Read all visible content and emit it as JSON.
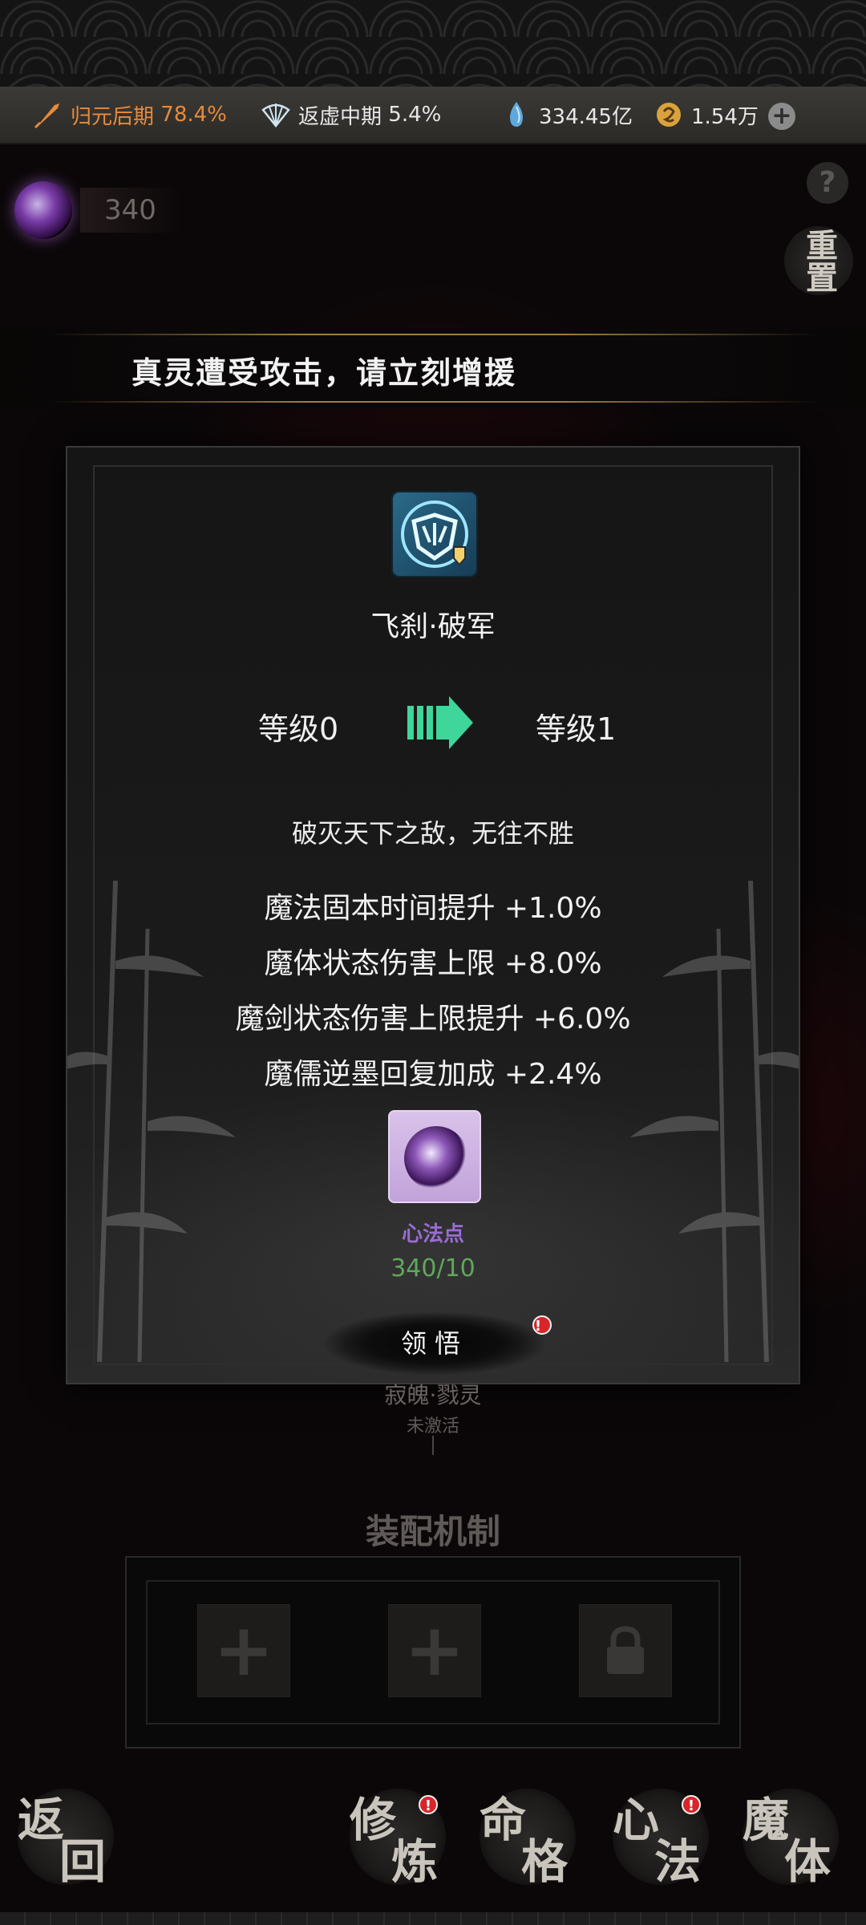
{
  "resources": {
    "realm1": {
      "name": "归元后期",
      "value": "78.4%",
      "icon": "sword-icon",
      "color": "#e88a3a"
    },
    "realm2": {
      "name": "返虚中期",
      "value": "5.4%",
      "icon": "fan-icon"
    },
    "spirit_stones": {
      "value": "334.45亿",
      "icon": "crystal-icon"
    },
    "jade": {
      "value": "1.54万",
      "icon": "coin-icon"
    },
    "add_icon": "plus-icon"
  },
  "header": {
    "points": "340",
    "help_label": "?",
    "reset_label": "重置"
  },
  "alert": {
    "text": "真灵遭受攻击，请立刻增援"
  },
  "modal": {
    "skill_name": "飞刹·破军",
    "level_from": "等级0",
    "level_to": "等级1",
    "description": "破灭天下之敌，无往不胜",
    "stats": [
      "魔法固本时间提升 +1.0%",
      "魔体状态伤害上限 +8.0%",
      "魔剑状态伤害上限提升 +6.0%",
      "魔儒逆墨回复加成 +2.4%"
    ],
    "cost_item_label": "心法点",
    "cost_count": "340/10",
    "action_label": "领悟",
    "badge": "!"
  },
  "node": {
    "name": "寂魄·戮灵",
    "status": "未激活"
  },
  "equip": {
    "title": "装配机制",
    "slots": [
      "+",
      "+",
      "locked"
    ]
  },
  "nav": {
    "back": [
      "返",
      "回"
    ],
    "cultivate": [
      "修",
      "炼"
    ],
    "fate": [
      "命",
      "格"
    ],
    "mind": [
      "心",
      "法"
    ],
    "demon": [
      "魔",
      "体"
    ],
    "badge": "!"
  },
  "colors": {
    "accent_orange": "#e88a3a",
    "item_purple": "#9a6cd2",
    "count_green": "#5fa85a",
    "arrow_green": "#3ed69a"
  }
}
